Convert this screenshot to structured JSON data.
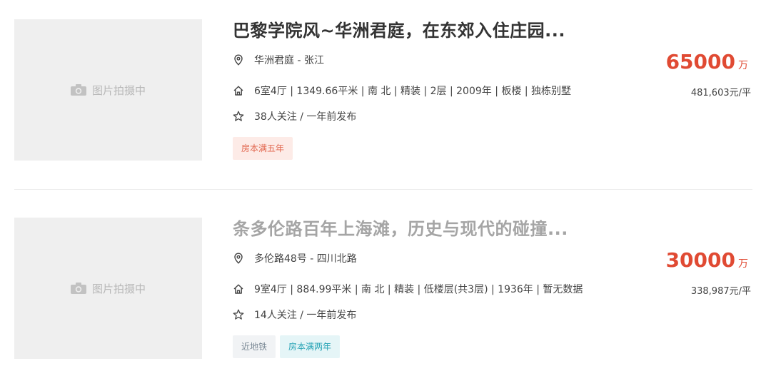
{
  "listings": [
    {
      "photo_text": "图片拍摄中",
      "title": "巴黎学院风~华洲君庭，在东郊入住庄园...",
      "location": "华洲君庭 - 张江",
      "info": "6室4厅 | 1349.66平米 | 南 北 | 精装 | 2层 | 2009年 | 板楼 | 独栋别墅",
      "follow": "38人关注 / 一年前发布",
      "price": "65000",
      "price_unit": "万",
      "unit_price": "481,603元/平",
      "tags": [
        "房本满五年"
      ]
    },
    {
      "photo_text": "图片拍摄中",
      "title": "条多伦路百年上海滩，历史与现代的碰撞...",
      "location": "多伦路48号 - 四川北路",
      "info": "9室4厅 | 884.99平米 | 南 北 | 精装 | 低楼层(共3层) | 1936年 | 暂无数据",
      "follow": "14人关注 / 一年前发布",
      "price": "30000",
      "price_unit": "万",
      "unit_price": "338,987元/平",
      "tags": [
        "近地铁",
        "房本满两年"
      ]
    }
  ],
  "icons": {
    "photo": "camera-icon",
    "location": "location-pin-icon",
    "info": "house-icon",
    "follow": "star-icon"
  },
  "colors": {
    "price": "#e04a33",
    "tag_red": "#e2674f",
    "tag_teal": "#29a4b6",
    "tag_gray": "#7c8a96"
  }
}
